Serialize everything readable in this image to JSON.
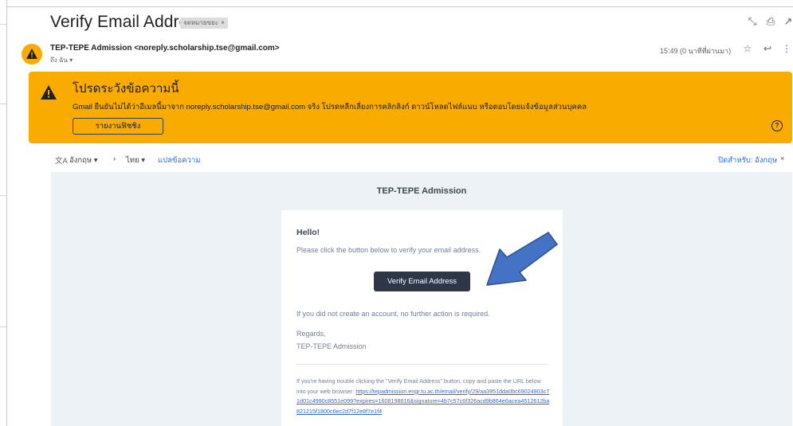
{
  "subject": {
    "title": "Verify Email Address",
    "label": "จดหมายขยะ",
    "label_close": "×"
  },
  "top_actions": {
    "expand_icon": "⤡",
    "print_icon": "⎙",
    "popout_icon": "↗"
  },
  "sender": {
    "name": "TEP-TEPE Admission <noreply.scholarship.tse@gmail.com>",
    "to": "ถึง ฉัน ▾",
    "time": "15:49 (0 นาทีที่ผ่านมา)",
    "star_icon": "☆",
    "reply_icon": "↩",
    "more_icon": "⋮"
  },
  "banner": {
    "title": "โปรดระวังข้อความนี้",
    "text": "Gmail ยืนยันไม่ได้ว่าอีเมลนี้มาจาก noreply.scholarship.tse@gmail.com จริง โปรดหลีกเลี่ยงการคลิกลิงก์ ดาวน์โหลดไฟล์แนบ หรือตอบโดยแจ้งข้อมูลส่วนบุคคล",
    "button": "รายงานฟิชชิง",
    "help": "?",
    "color": "#f9ab00"
  },
  "translate": {
    "icon": "文A",
    "from": "อังกฤษ ▾",
    "arrow": "›",
    "to": "ไทย ▾",
    "action": "แปลข้อความ",
    "turn_off": "ปิดสำหรับ: อังกฤษ",
    "close": "×"
  },
  "email": {
    "brand": "TEP-TEPE Admission",
    "hello": "Hello!",
    "intro": "Please click the button below to verify your email address.",
    "button": "Verify Email Address",
    "no_action": "If you did not create an account, no further action is required.",
    "regards": "Regards,",
    "signature": "TEP-TEPE Admission",
    "subcopy_prefix": "If you're having trouble clicking the \"Verify Email Address\" button, copy and paste the URL below into your web browser: ",
    "url": "https://tepadmission.engr.tu.ac.th/email/verify/29/aa3951dda0bc69024903c71d01c4990c8551e099?expires=1608198616&signature=4b7c57c6f326acd9b864e6acea4512612ba821215f1800c6ec2d7f12e8f7e1f4"
  },
  "colors": {
    "accent": "#1a73e8",
    "button_dark": "#2d3748",
    "arrow_fill": "#4472c4"
  }
}
